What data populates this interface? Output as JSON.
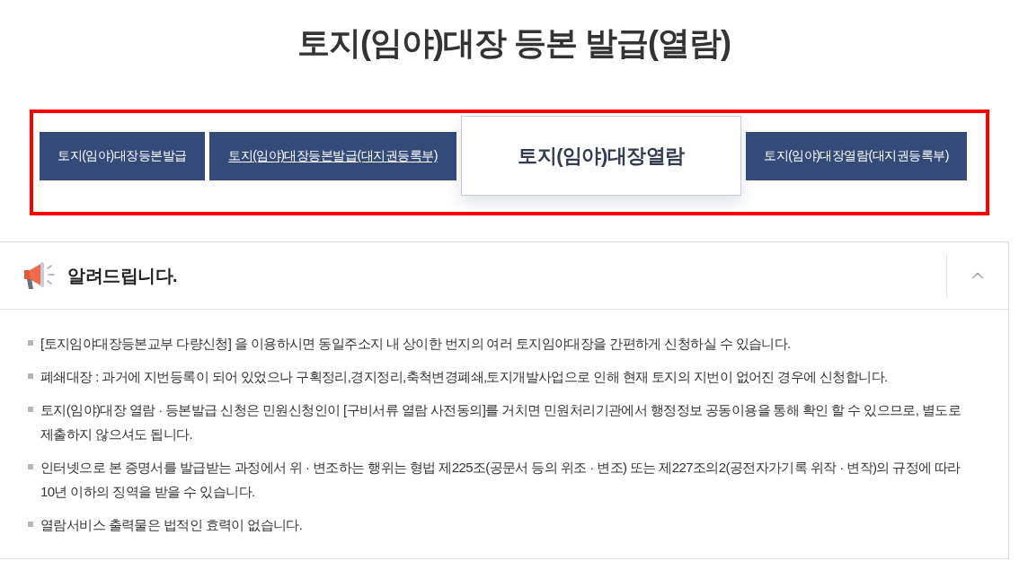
{
  "page_title": "토지(임야)대장 등본 발급(열람)",
  "tab_group": {
    "highlighted": true,
    "tabs": [
      {
        "label": "토지(임야)대장등본발급",
        "selected": false,
        "underlined": false
      },
      {
        "label": "토지(임야)대장등본발급(대지권등록부)",
        "selected": false,
        "underlined": true
      },
      {
        "label": "토지(임야)대장열람",
        "selected": true,
        "underlined": false
      },
      {
        "label": "토지(임야)대장열람(대지권등록부)",
        "selected": false,
        "underlined": false
      }
    ]
  },
  "notice": {
    "title": "알려드립니다.",
    "expanded": true,
    "items": [
      "[토지임야대장등본교부 다량신청] 을 이용하시면 동일주소지 내 상이한 번지의 여러 토지임야대장을 간편하게 신청하실 수 있습니다.",
      "폐쇄대장 : 과거에 지번등록이 되어 있었으나 구획정리,경지정리,축척변경폐쇄,토지개발사업으로 인해 현재 토지의 지번이 없어진 경우에 신청합니다.",
      "토지(임야)대장 열람 · 등본발급 신청은 민원신청인이 [구비서류 열람 사전동의]를 거치면 민원처리기관에서 행정정보 공동이용을 통해 확인 할 수 있으므로, 별도로 제출하지 않으셔도 됩니다.",
      "인터넷으로 본 증명서를 발급받는 과정에서 위 · 변조하는 행위는 형법 제225조(공문서 등의 위조 · 변조) 또는 제227조의2(공전자가기록 위작 · 변작)의 규정에 따라 10년 이하의 징역을 받을 수 있습니다.",
      "열람서비스 출력물은 법적인 효력이 없습니다."
    ]
  }
}
